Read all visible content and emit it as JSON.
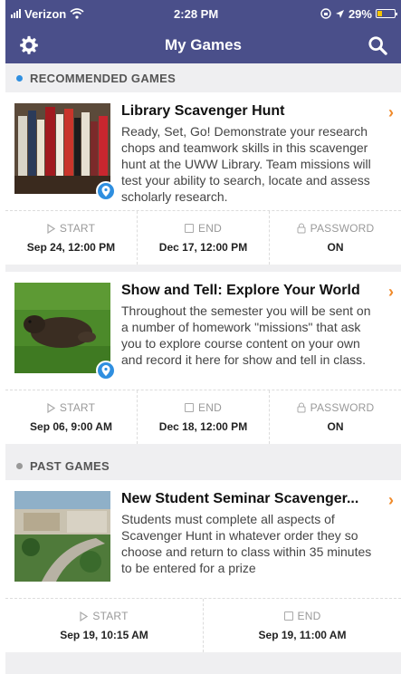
{
  "status": {
    "carrier": "Verizon",
    "time": "2:28 PM",
    "battery": "29%",
    "battery_level": 0.29
  },
  "header": {
    "title": "My Games",
    "left_icon": "gear-icon",
    "right_icon": "search-icon"
  },
  "colors": {
    "nav": "#4a4f8a",
    "recommended_dot": "#2f8fe0",
    "past_dot": "#999999",
    "accent": "#f08a2a",
    "pin": "#2f8fe0"
  },
  "sections": {
    "recommended": {
      "title": "RECOMMENDED GAMES"
    },
    "past": {
      "title": "PAST GAMES"
    }
  },
  "games": [
    {
      "title": "Library Scavenger Hunt",
      "description": "Ready, Set, Go! Demonstrate your research chops and teamwork skills in this scavenger hunt at the UWW Library. Team missions will test your ability to search, locate and assess scholarly research.",
      "start_label": "START",
      "start_value": "Sep 24, 12:00 PM",
      "end_label": "END",
      "end_value": "Dec 17, 12:00 PM",
      "password_label": "PASSWORD",
      "password_value": "ON"
    },
    {
      "title": "Show and Tell: Explore Your World",
      "description": "Throughout the semester you will be sent on a number of homework \"missions\" that ask you to explore course content on your own and record it here for show and tell in class.",
      "start_label": "START",
      "start_value": "Sep 06, 9:00 AM",
      "end_label": "END",
      "end_value": "Dec 18, 12:00 PM",
      "password_label": "PASSWORD",
      "password_value": "ON"
    },
    {
      "title": "New Student Seminar Scavenger...",
      "description": "Students must complete all aspects of Scavenger Hunt in whatever order they so choose and return to class within 35 minutes to be entered for a prize",
      "start_label": "START",
      "start_value": "Sep 19, 10:15 AM",
      "end_label": "END",
      "end_value": "Sep 19, 11:00 AM"
    }
  ]
}
